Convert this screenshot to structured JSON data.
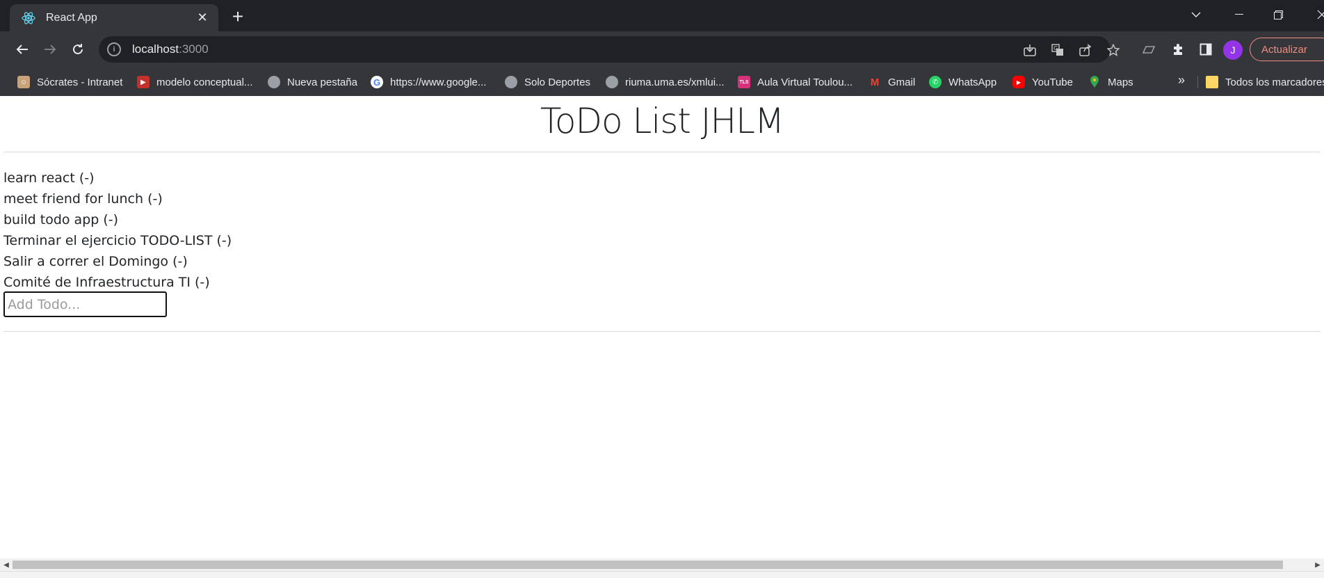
{
  "browser": {
    "tab": {
      "title": "React App",
      "favicon": "react-icon"
    },
    "address": {
      "host": "localhost",
      "port": ":3000"
    },
    "update_label": "Actualizar",
    "avatar_initial": "J",
    "bookmarks": [
      {
        "label": "Sócrates - Intranet",
        "icon": "socrates-icon",
        "color": "#8d5a2b"
      },
      {
        "label": "modelo conceptual...",
        "icon": "youtube-icon",
        "color": "#c4302b"
      },
      {
        "label": "Nueva pestaña",
        "icon": "globe-icon",
        "color": "#9aa0a6"
      },
      {
        "label": "https://www.google...",
        "icon": "google-icon",
        "color": "#4285f4"
      },
      {
        "label": "Solo Deportes",
        "icon": "globe-icon",
        "color": "#9aa0a6"
      },
      {
        "label": "riuma.uma.es/xmlui...",
        "icon": "globe-icon",
        "color": "#9aa0a6"
      },
      {
        "label": "Aula Virtual Toulou...",
        "icon": "tls-icon",
        "color": "#d6317b"
      },
      {
        "label": "Gmail",
        "icon": "gmail-icon",
        "color": "#ea4335"
      },
      {
        "label": "WhatsApp",
        "icon": "whatsapp-icon",
        "color": "#25d366"
      },
      {
        "label": "YouTube",
        "icon": "youtube-icon",
        "color": "#ff0000"
      },
      {
        "label": "Maps",
        "icon": "maps-icon",
        "color": "#34a853"
      }
    ],
    "bookmarks_more": "»",
    "all_bookmarks_label": "Todos los marcadores"
  },
  "app": {
    "title": "ToDo List JHLM",
    "todos": [
      {
        "text": "learn react",
        "delete": "(-)"
      },
      {
        "text": "meet friend for lunch",
        "delete": "(-)"
      },
      {
        "text": "build todo app",
        "delete": "(-)"
      },
      {
        "text": "Terminar el ejercicio TODO-LIST",
        "delete": "(-)"
      },
      {
        "text": "Salir a correr el Domingo",
        "delete": "(-)"
      },
      {
        "text": "Comité de Infraestructura TI",
        "delete": "(-)"
      }
    ],
    "input": {
      "placeholder": "Add Todo...",
      "value": ""
    }
  }
}
